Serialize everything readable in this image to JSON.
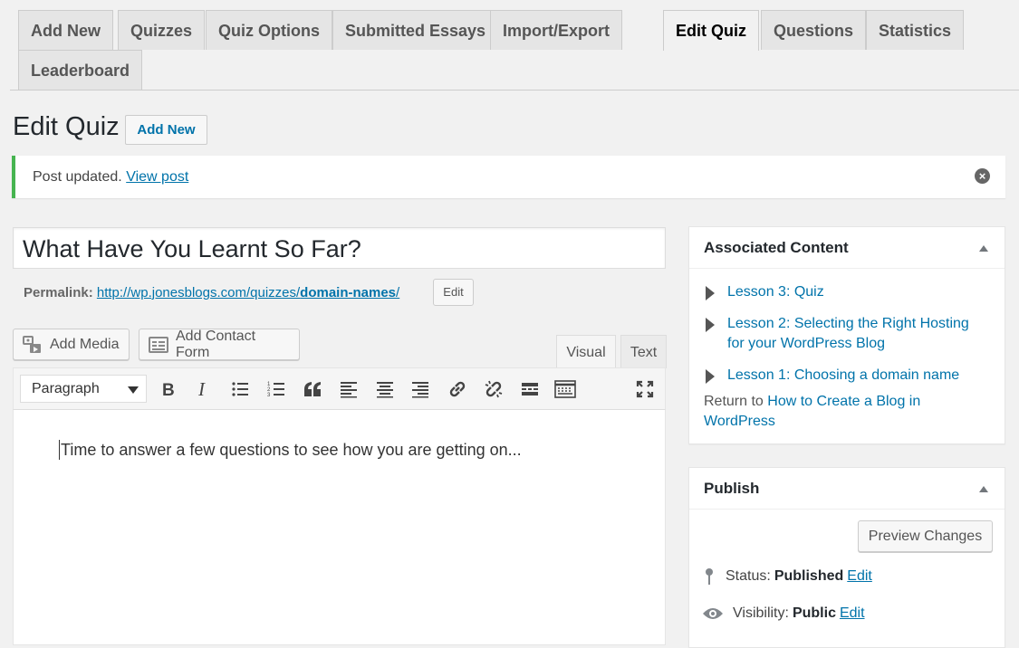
{
  "tabs": {
    "add_new": "Add New",
    "quizzes": "Quizzes",
    "quiz_options": "Quiz Options",
    "submitted_essays": "Submitted Essays",
    "import_export": "Import/Export",
    "edit_quiz": "Edit Quiz",
    "questions": "Questions",
    "statistics": "Statistics",
    "leaderboard": "Leaderboard"
  },
  "header": {
    "title": "Edit Quiz",
    "add_new": "Add New"
  },
  "notice": {
    "text": "Post updated.",
    "link": "View post",
    "dismiss_icon": "dismiss-icon",
    "accent": "#46b450"
  },
  "post": {
    "title": "What Have You Learnt So Far?",
    "permalink_label": "Permalink:",
    "permalink_base": "http://wp.jonesblogs.com/quizzes/",
    "permalink_slug": "domain-names",
    "permalink_trailing": "/",
    "edit_slug": "Edit"
  },
  "media": {
    "add_media": "Add Media",
    "add_contact_form": "Add Contact Form"
  },
  "editor": {
    "tab_visual": "Visual",
    "tab_text": "Text",
    "format": "Paragraph",
    "content": "Time to answer a few questions to see how you are getting on...",
    "toolbar_icons": [
      "bold-icon",
      "italic-icon",
      "bulleted-list-icon",
      "numbered-list-icon",
      "blockquote-icon",
      "align-left-icon",
      "align-center-icon",
      "align-right-icon",
      "insert-link-icon",
      "remove-link-icon",
      "read-more-icon",
      "toolbar-toggle-icon",
      "fullscreen-icon"
    ]
  },
  "associated_content": {
    "title": "Associated Content",
    "lessons": [
      {
        "line1": "Lesson 3: Quiz",
        "line2": ""
      },
      {
        "line1": "Lesson 2: Selecting the Right Hosting",
        "line2": "for your WordPress Blog"
      },
      {
        "line1": "Lesson 1: Choosing a domain name",
        "line2": ""
      }
    ],
    "return_prefix": "Return to",
    "return_link_line1": "How to Create a Blog in",
    "return_link_line2": "WordPress"
  },
  "publish": {
    "title": "Publish",
    "preview": "Preview Changes",
    "status_label": "Status:",
    "status_value": "Published",
    "status_edit": "Edit",
    "visibility_label": "Visibility:",
    "visibility_value": "Public",
    "visibility_edit": "Edit"
  }
}
